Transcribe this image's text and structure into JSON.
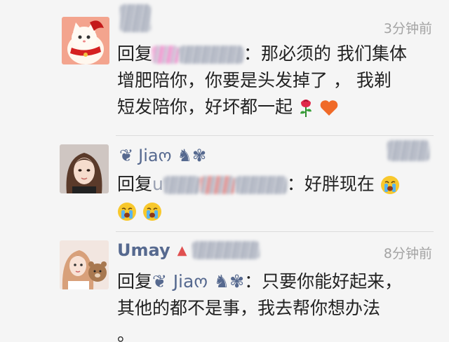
{
  "comments": [
    {
      "time": "3分钟前",
      "reply_prefix": "回复",
      "colon": "：",
      "text_line1": "那必须的 我们集体",
      "text_line2": "增肥陪你，你要是头发掉了 ，  我剃",
      "text_line3": "短发陪你，好坏都一起",
      "emojis": [
        "rose-icon",
        "orange-heart-icon"
      ]
    },
    {
      "name": "Jiaო",
      "name_deco_left": "❦",
      "name_deco_right": "♞✾",
      "reply_prefix": "回复",
      "reply_partial": "u",
      "colon": "：",
      "text": "好胖现在",
      "emojis": [
        "crying-face-icon",
        "crying-face-icon",
        "crying-face-icon"
      ]
    },
    {
      "name": "Umay",
      "warning_glyph": "▲",
      "time": "8分钟前",
      "reply_prefix": "回复",
      "mention_deco_left": "❦",
      "mention_name": "Jiaო",
      "mention_deco_right": "♞✾",
      "colon": "：",
      "text_line1": "只要你能好起来，",
      "text_line2": "其他的都不是事，我去帮你想办法",
      "text_line3": "。"
    }
  ],
  "colors": {
    "name": "#56698f",
    "time": "#a3a3a3",
    "text": "#222222",
    "background": "#f5f5f5"
  }
}
